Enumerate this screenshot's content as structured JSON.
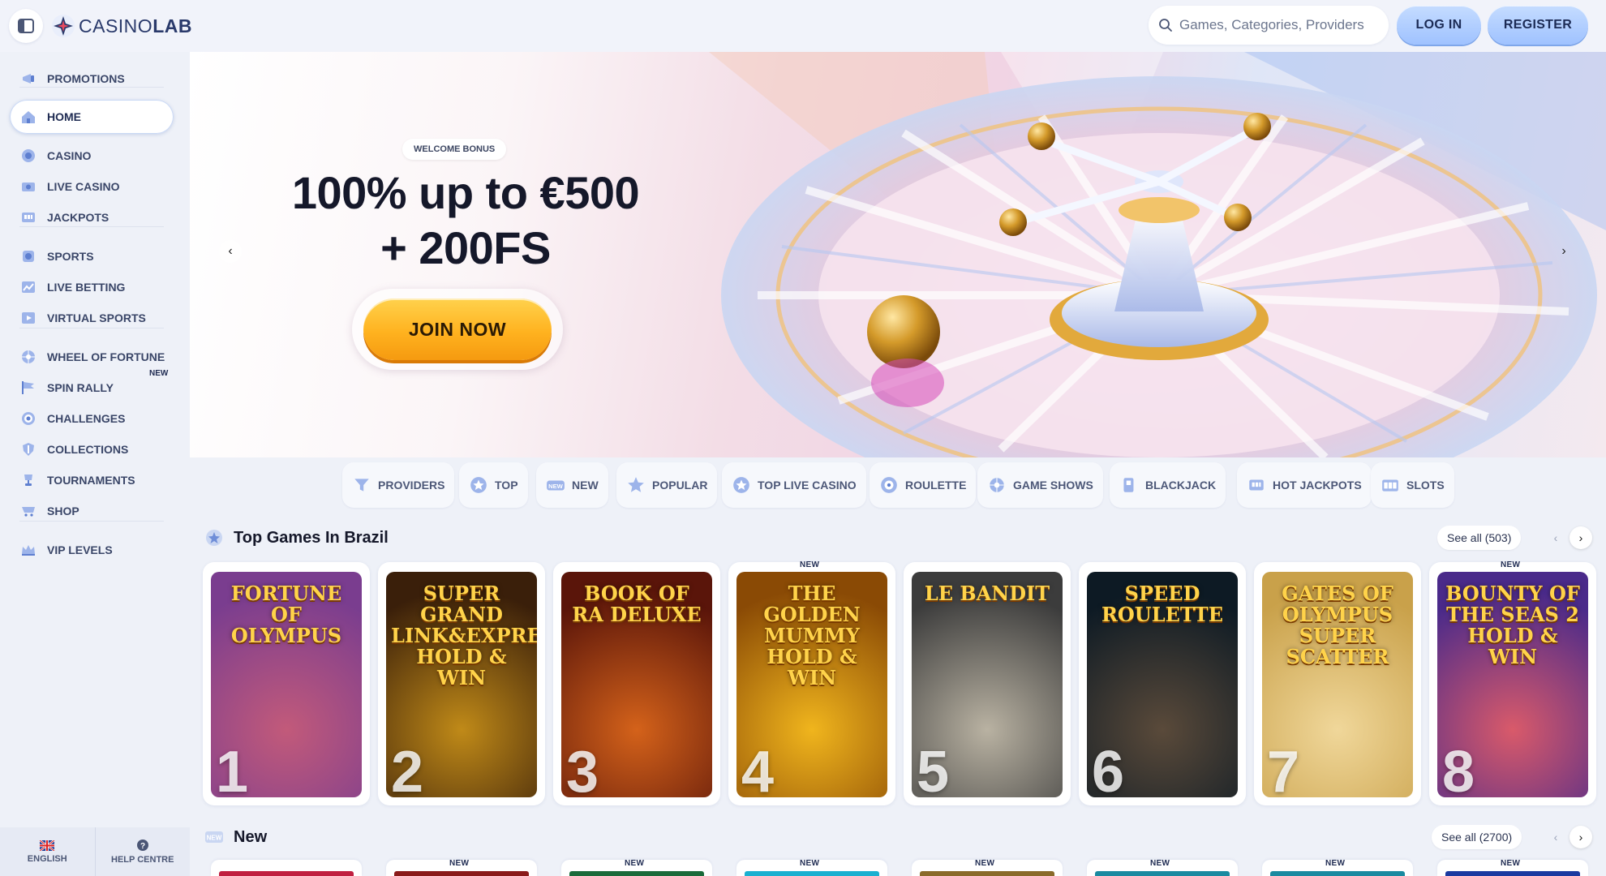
{
  "brand": {
    "name_light": "CASINO",
    "name_bold": "LAB"
  },
  "search": {
    "placeholder": "Games, Categories, Providers"
  },
  "auth": {
    "login_label": "LOG IN",
    "register_label": "REGISTER"
  },
  "sidebar": {
    "items": [
      {
        "label": "PROMOTIONS",
        "icon": "megaphone-icon"
      },
      {
        "label": "HOME",
        "icon": "home-icon",
        "active": true
      },
      {
        "label": "CASINO",
        "icon": "chip-icon"
      },
      {
        "label": "LIVE CASINO",
        "icon": "camera-icon"
      },
      {
        "label": "JACKPOTS",
        "icon": "jackpot-icon"
      },
      {
        "label": "SPORTS",
        "icon": "ball-icon"
      },
      {
        "label": "LIVE BETTING",
        "icon": "chart-icon"
      },
      {
        "label": "VIRTUAL SPORTS",
        "icon": "play-icon"
      },
      {
        "label": "WHEEL OF FORTUNE",
        "icon": "wheel-icon"
      },
      {
        "label": "SPIN RALLY",
        "icon": "flag-icon",
        "badge": "NEW"
      },
      {
        "label": "CHALLENGES",
        "icon": "target-icon"
      },
      {
        "label": "COLLECTIONS",
        "icon": "shield-icon"
      },
      {
        "label": "TOURNAMENTS",
        "icon": "trophy-icon"
      },
      {
        "label": "SHOP",
        "icon": "cart-icon"
      },
      {
        "label": "VIP LEVELS",
        "icon": "crown-icon"
      }
    ],
    "footer": {
      "language": "ENGLISH",
      "help": "HELP CENTRE"
    }
  },
  "hero": {
    "badge": "WELCOME BONUS",
    "title_line1": "100% up to €500",
    "title_line2": "+ 200FS",
    "cta": "JOIN NOW"
  },
  "categories": [
    {
      "label": "PROVIDERS",
      "icon": "funnel-icon"
    },
    {
      "label": "TOP",
      "icon": "star-badge-icon"
    },
    {
      "label": "NEW",
      "icon": "new-badge-icon"
    },
    {
      "label": "POPULAR",
      "icon": "star-icon"
    },
    {
      "label": "TOP LIVE CASINO",
      "icon": "star-badge-icon"
    },
    {
      "label": "ROULETTE",
      "icon": "roulette-icon"
    },
    {
      "label": "GAME SHOWS",
      "icon": "wheel-icon"
    },
    {
      "label": "BLACKJACK",
      "icon": "cards-icon"
    },
    {
      "label": "HOT JACKPOTS",
      "icon": "jackpot-icon"
    },
    {
      "label": "SLOTS",
      "icon": "slots-icon"
    }
  ],
  "top_games": {
    "title": "Top Games In Brazil",
    "see_all": "See all (503)",
    "games": [
      {
        "name": "FORTUNE OF OLYMPUS",
        "rank": "1",
        "tag": "",
        "colors": [
          "#7a3d8f",
          "#c25a7a"
        ]
      },
      {
        "name": "SUPER GRAND LINK&EXPRESS HOLD & WIN",
        "rank": "2",
        "tag": "",
        "colors": [
          "#3a1f0a",
          "#c08a18"
        ]
      },
      {
        "name": "BOOK OF RA DELUXE",
        "rank": "3",
        "tag": "",
        "colors": [
          "#5a150a",
          "#d4621a"
        ]
      },
      {
        "name": "THE GOLDEN MUMMY HOLD & WIN",
        "rank": "4",
        "tag": "NEW",
        "colors": [
          "#8a4a05",
          "#f0b51d"
        ]
      },
      {
        "name": "LE BANDIT",
        "rank": "5",
        "tag": "",
        "colors": [
          "#3c3c3c",
          "#b9b2a2"
        ]
      },
      {
        "name": "SPEED ROULETTE",
        "rank": "6",
        "tag": "",
        "colors": [
          "#0d1a24",
          "#5a4a3a"
        ]
      },
      {
        "name": "GATES OF OLYMPUS SUPER SCATTER",
        "rank": "7",
        "tag": "",
        "colors": [
          "#c9a14a",
          "#f0d79a"
        ]
      },
      {
        "name": "BOUNTY OF THE SEAS 2 HOLD & WIN",
        "rank": "8",
        "tag": "NEW",
        "colors": [
          "#4a2a8a",
          "#d95a6a"
        ]
      }
    ]
  },
  "new_games": {
    "title": "New",
    "see_all": "See all (2700)",
    "tags": [
      "",
      "NEW",
      "NEW",
      "NEW",
      "NEW",
      "NEW",
      "NEW",
      "NEW"
    ],
    "colors": [
      "#c02040",
      "#8a1a1a",
      "#1a6a3a",
      "#1ab0d0",
      "#8a6a2a",
      "#1a8aa0",
      "#1a8aa0",
      "#1a3aa0"
    ]
  }
}
